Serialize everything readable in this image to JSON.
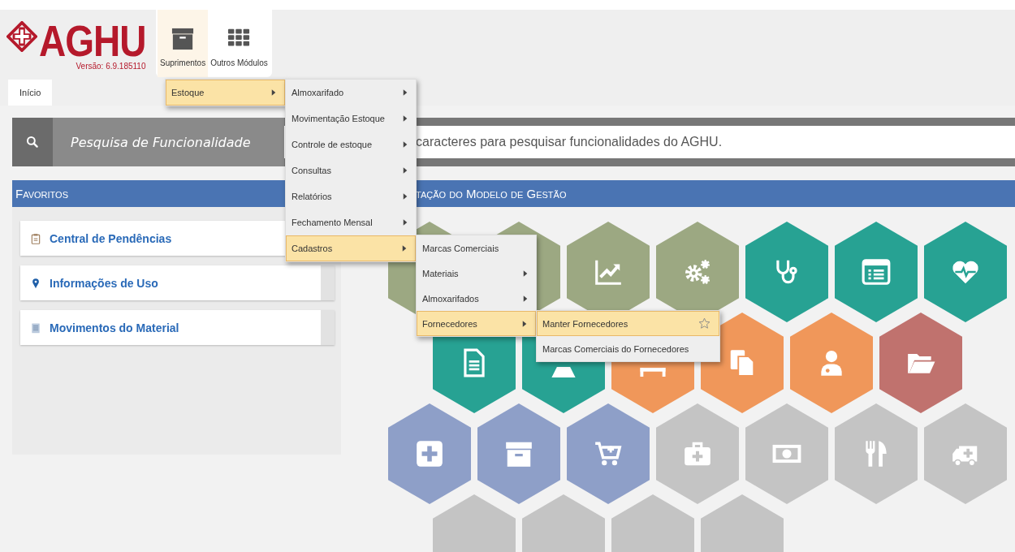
{
  "logo": {
    "name": "AGHU",
    "version": "Versão: 6.9.185110"
  },
  "modules": [
    {
      "label": "Suprimentos",
      "kind": "box",
      "selected": true
    },
    {
      "label": "Outros Módulos",
      "kind": "grid",
      "selected": false
    }
  ],
  "tabs": [
    {
      "label": "Início",
      "selected": true
    }
  ],
  "menu": [
    {
      "label": "Estoque",
      "selected": true,
      "submenu": true,
      "children": [
        {
          "label": "Almoxarifado",
          "selected": false,
          "submenu": true
        },
        {
          "label": "Movimentação Estoque",
          "selected": false,
          "submenu": true
        },
        {
          "label": "Controle de estoque",
          "selected": false,
          "submenu": true
        },
        {
          "label": "Consultas",
          "selected": false,
          "submenu": true
        },
        {
          "label": "Relatórios",
          "selected": false,
          "submenu": true
        },
        {
          "label": "Fechamento Mensal",
          "selected": false,
          "submenu": true
        },
        {
          "label": "Cadastros",
          "selected": true,
          "submenu": true,
          "children": [
            {
              "label": "Marcas Comerciais",
              "selected": false,
              "submenu": false
            },
            {
              "label": "Materiais",
              "selected": false,
              "submenu": true
            },
            {
              "label": "Almoxarifados",
              "selected": false,
              "submenu": true
            },
            {
              "label": "Fornecedores",
              "selected": true,
              "submenu": true,
              "children": [
                {
                  "label": "Manter Fornecedores",
                  "selected": true,
                  "submenu": false,
                  "favorite": false
                },
                {
                  "label": "Marcas Comerciais do Fornecedores",
                  "selected": false,
                  "submenu": false
                }
              ]
            }
          ]
        }
      ]
    }
  ],
  "search": {
    "label": "Pesquisa de Funcionalidade",
    "placeholder": "caracteres para pesquisar funcionalidades do AGHU."
  },
  "favorites": {
    "title": "Favoritos",
    "items": [
      {
        "label": "Central de Pendências",
        "kind": "clipboard"
      },
      {
        "label": "Informações de Uso",
        "kind": "pin"
      },
      {
        "label": "Movimentos do Material",
        "kind": "sheet"
      }
    ]
  },
  "model": {
    "title": "tação do Modelo de Gestão",
    "rows": [
      [
        {
          "kind": "blank",
          "color": "#9ca882"
        },
        {
          "kind": "blank",
          "color": "#9ca882"
        },
        {
          "kind": "chart",
          "color": "#9ca882"
        },
        {
          "kind": "gears",
          "color": "#9ca882"
        },
        {
          "kind": "stethoscope",
          "color": "#27a293"
        },
        {
          "kind": "list",
          "color": "#27a293"
        },
        {
          "kind": "heart",
          "color": "#27a293"
        }
      ],
      [
        {
          "kind": "doc",
          "color": "#27a293"
        },
        {
          "kind": "flask",
          "color": "#27a293"
        },
        {
          "kind": "bed",
          "color": "#f0975a"
        },
        {
          "kind": "copy",
          "color": "#f0975a"
        },
        {
          "kind": "doctor",
          "color": "#f0975a"
        },
        {
          "kind": "folder",
          "color": "#c0726e"
        }
      ],
      [
        {
          "kind": "plus",
          "color": "#8e9fc8"
        },
        {
          "kind": "archive",
          "color": "#8e9fc8"
        },
        {
          "kind": "cart",
          "color": "#8e9fc8"
        },
        {
          "kind": "medkit",
          "color": "#c4c4c4"
        },
        {
          "kind": "money",
          "color": "#c4c4c4"
        },
        {
          "kind": "utensils",
          "color": "#c4c4c4"
        },
        {
          "kind": "ambulance",
          "color": "#c4c4c4"
        }
      ],
      [
        {
          "kind": "blank",
          "color": "#c4c4c4"
        },
        {
          "kind": "blank",
          "color": "#c4c4c4"
        },
        {
          "kind": "blank",
          "color": "#c4c4c4"
        },
        {
          "kind": "blank",
          "color": "#c4c4c4"
        }
      ]
    ]
  }
}
